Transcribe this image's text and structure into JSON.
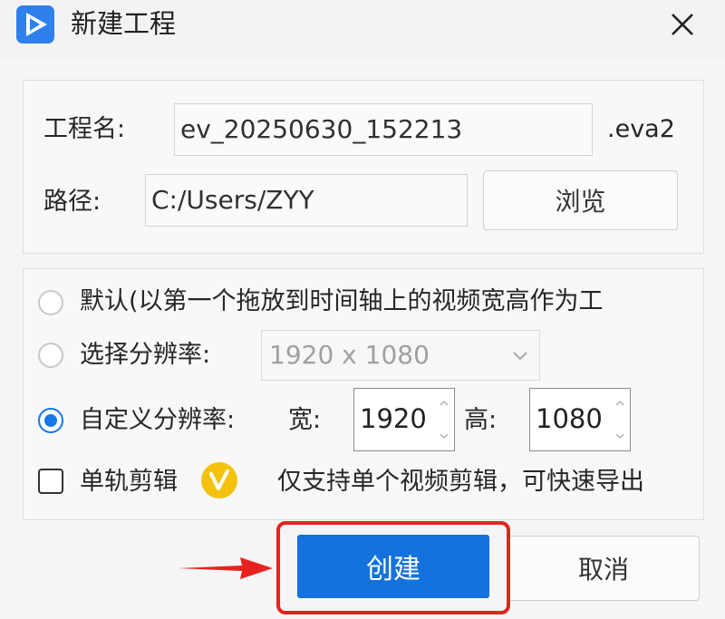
{
  "window": {
    "title": "新建工程",
    "icon": "play-logo-icon",
    "close_icon": "close-icon"
  },
  "project": {
    "name_label": "工程名:",
    "name_value": "ev_20250630_152213",
    "extension": ".eva2",
    "path_label": "路径:",
    "path_value": "C:/Users/ZYY",
    "browse_label": "浏览"
  },
  "resolution": {
    "default_label": "默认(以第一个拖放到时间轴上的视频宽高作为工",
    "select_label": "选择分辨率:",
    "select_value": "1920 x 1080",
    "custom_label": "自定义分辨率:",
    "width_label": "宽:",
    "width_value": "1920",
    "height_label": "高:",
    "height_value": "1080",
    "selected": "custom"
  },
  "single_track": {
    "label": "单轨剪辑",
    "badge_icon": "vip-v-badge-icon",
    "description": "仅支持单个视频剪辑，可快速导出",
    "checked": false
  },
  "actions": {
    "create_label": "创建",
    "cancel_label": "取消"
  },
  "colors": {
    "accent": "#1372dc",
    "highlight": "#e8221e",
    "vip": "#f4c20d"
  }
}
